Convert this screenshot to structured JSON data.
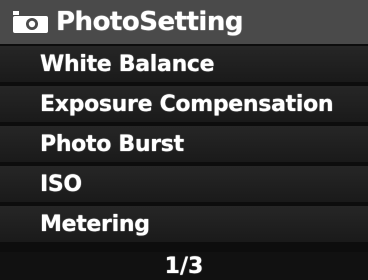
{
  "header": {
    "icon": "camera-icon",
    "title": "PhotoSetting"
  },
  "menu": {
    "items": [
      {
        "label": "White Balance"
      },
      {
        "label": "Exposure Compensation"
      },
      {
        "label": "Photo Burst"
      },
      {
        "label": "ISO"
      },
      {
        "label": "Metering"
      }
    ]
  },
  "footer": {
    "page_indicator": "1/3"
  },
  "colors": {
    "background": "#0d0d0d",
    "header_bg": "#4a4a4a",
    "item_bg": "#222222",
    "text": "#ffffff"
  }
}
